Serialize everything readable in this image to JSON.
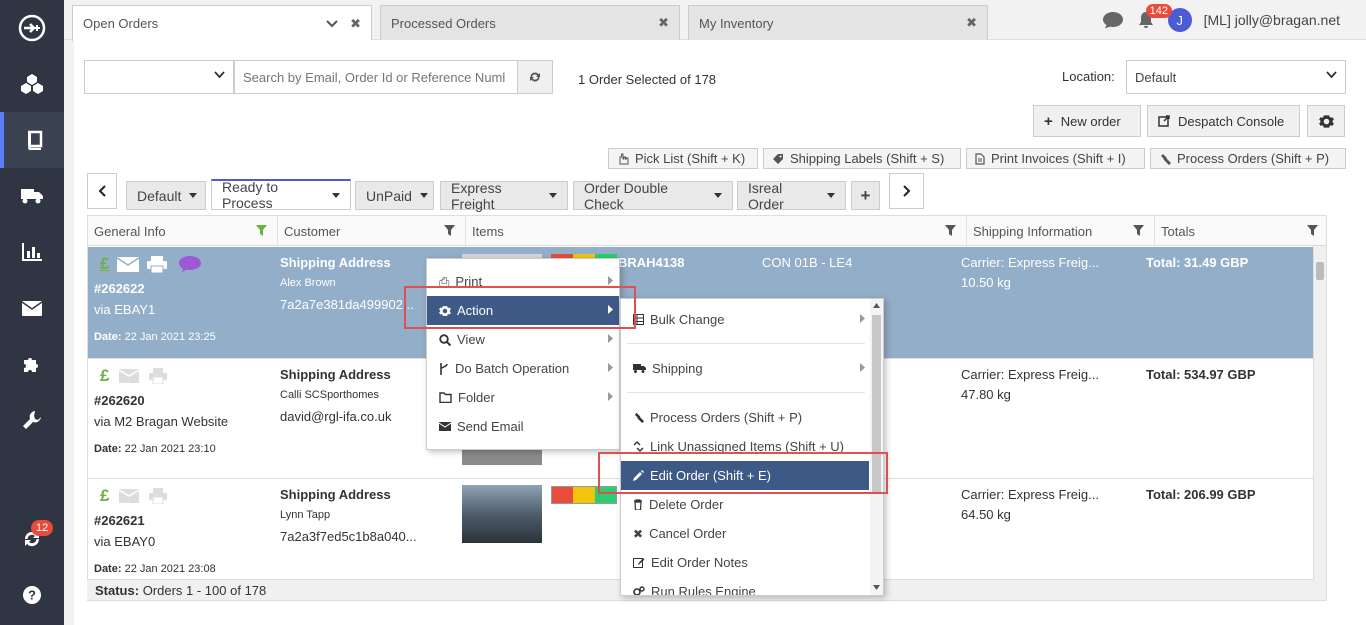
{
  "sidebar": {
    "badge": "12"
  },
  "tabs": [
    {
      "label": "Open Orders"
    },
    {
      "label": "Processed Orders"
    },
    {
      "label": "My Inventory"
    }
  ],
  "topbar": {
    "notification_count": "142",
    "avatar_initial": "J",
    "user": "[ML] jolly@bragan.net"
  },
  "toolbar": {
    "search_placeholder": "Search by Email, Order Id or Reference Numl",
    "selection_status": "1 Order Selected of 178",
    "location_label": "Location:",
    "location_value": "Default",
    "new_order": "New order",
    "despatch_console": "Despatch Console"
  },
  "shortcuts": {
    "pick_list": "Pick List (Shift + K)",
    "shipping_labels": "Shipping Labels (Shift + S)",
    "print_invoices": "Print Invoices (Shift + I)",
    "process_orders": "Process Orders (Shift + P)"
  },
  "views": [
    {
      "label": "Default"
    },
    {
      "label": "Ready to Process"
    },
    {
      "label": "UnPaid"
    },
    {
      "label": "Express Freight"
    },
    {
      "label": "Order Double Check"
    },
    {
      "label": "Isreal Order"
    }
  ],
  "grid": {
    "columns": [
      "General Info",
      "Customer",
      "Items",
      "Shipping Information",
      "Totals"
    ],
    "rows": [
      {
        "id": "#262622",
        "via": "via EBAY1",
        "date_label": "Date:",
        "date": "22 Jan 2021 23:25",
        "ship_title": "Shipping Address",
        "name": "Alex Brown",
        "contact": "7a2a7e381da499902...",
        "sku": "BRAH4138",
        "location": "CON 01B - LE4",
        "carrier": "Carrier: Express Freig...",
        "weight": "10.50 kg",
        "total": "Total: 31.49 GBP"
      },
      {
        "id": "#262620",
        "via": "via M2 Bragan Website",
        "date_label": "Date:",
        "date": "22 Jan 2021 23:10",
        "ship_title": "Shipping Address",
        "name": "Calli SCSporthomes",
        "contact": "david@rgl-ifa.co.uk",
        "carrier": "Carrier: Express Freig...",
        "weight": "47.80 kg",
        "total": "Total: 534.97 GBP"
      },
      {
        "id": "#262621",
        "via": "via EBAY0",
        "date_label": "Date:",
        "date": "22 Jan 2021 23:08",
        "ship_title": "Shipping Address",
        "name": "Lynn Tapp",
        "contact": "7a2a3f7ed5c1b8a040...",
        "carrier": "Carrier: Express Freig...",
        "weight": "64.50 kg",
        "total": "Total: 206.99 GBP"
      }
    ]
  },
  "status": {
    "label": "Status:",
    "text": "Orders 1 - 100 of 178"
  },
  "context_menu": {
    "items": [
      "Print",
      "Action",
      "View",
      "Do Batch Operation",
      "Folder",
      "Send Email"
    ]
  },
  "submenu": {
    "items": [
      "Bulk Change",
      "Shipping",
      "Process Orders (Shift + P)",
      "Link Unassigned Items (Shift + U)",
      "Edit Order (Shift + E)",
      "Delete Order",
      "Cancel Order",
      "Edit Order Notes",
      "Run Rules Engine"
    ]
  },
  "colors": {
    "sidebar": "#2f3542",
    "selected_row": "#93aec9",
    "menu_highlight": "#3d5a86",
    "callout": "#e05050"
  }
}
